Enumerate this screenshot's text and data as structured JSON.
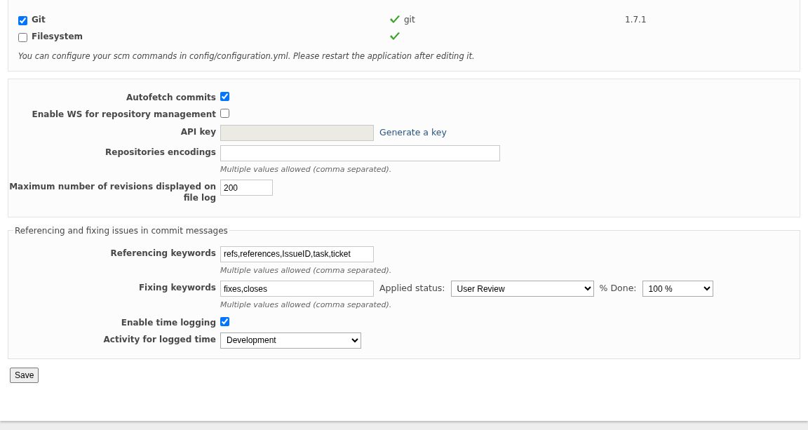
{
  "scm": [
    {
      "name": "Git",
      "enabled": true,
      "available": true,
      "command": "git",
      "version": "1.7.1"
    },
    {
      "name": "Filesystem",
      "enabled": false,
      "available": true
    }
  ],
  "scm_note": "You can configure your scm commands in config/configuration.yml. Please restart the application after editing it.",
  "settings": [
    {
      "kind": "checkbox",
      "label": "Autofetch commits",
      "checked": true
    },
    {
      "kind": "checkbox",
      "label": "Enable WS for repository management",
      "checked": false
    },
    {
      "kind": "apikey",
      "label": "API key",
      "link": "Generate a key"
    },
    {
      "kind": "wide",
      "label": "Repositories encodings",
      "hint": "Multiple values allowed (comma separated)."
    },
    {
      "kind": "short",
      "label": "Maximum number of revisions displayed on file log",
      "value": "200"
    }
  ],
  "issues": {
    "legend": "Referencing and fixing issues in commit messages",
    "fields": [
      {
        "kind": "text",
        "label": "Referencing keywords",
        "value": "refs,references,IssueID,task,ticket",
        "hint": "Multiple values allowed (comma separated)."
      },
      {
        "kind": "text",
        "label": "Fixing keywords",
        "value": "fixes,closes",
        "hint": "Multiple values allowed (comma separated).",
        "extras": [
          {
            "label": "Applied status:",
            "value": "User Review"
          },
          {
            "label": "% Done:",
            "value": "100 %"
          }
        ]
      },
      {
        "kind": "checkbox",
        "label": "Enable time logging",
        "checked": true
      },
      {
        "kind": "select",
        "label": "Activity for logged time",
        "value": "Development"
      }
    ]
  },
  "save": "Save"
}
